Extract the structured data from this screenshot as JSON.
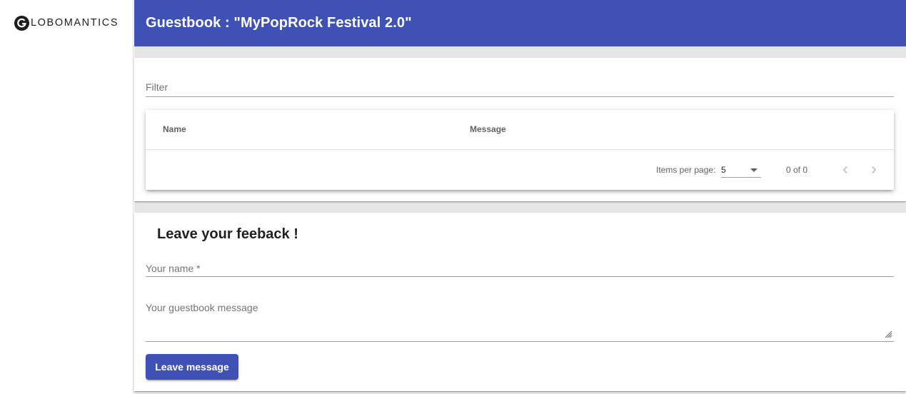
{
  "sidebar": {
    "logo_text": "LOBOMANTICS",
    "logo_letter": "G"
  },
  "header": {
    "title": "Guestbook : \"MyPopRock Festival 2.0\""
  },
  "list": {
    "filter_placeholder": "Filter",
    "columns": [
      "Name",
      "Message"
    ],
    "rows": [],
    "paginator": {
      "items_per_page_label": "Items per page:",
      "page_size": "5",
      "range_label": "0 of 0",
      "prev_icon": "chevron-left-icon",
      "next_icon": "chevron-right-icon"
    }
  },
  "form": {
    "title": "Leave your feeback !",
    "name_placeholder": "Your name *",
    "name_value": "",
    "message_placeholder": "Your guestbook message",
    "message_value": "",
    "submit_label": "Leave message"
  },
  "colors": {
    "primary": "#3f51b5",
    "background": "#e6e6e6"
  }
}
